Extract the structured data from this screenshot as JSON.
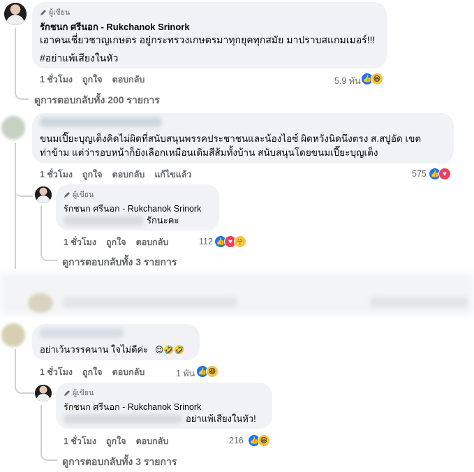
{
  "comment1": {
    "author_badge": "ผู้เขียน",
    "author_name": "รักชนก ศรีนอก - Rukchanok Srinork",
    "line1": "เอาคนเชี่ยวชาญเกษตร อยู่กระทรวงเกษตรมาทุกยุคทุกสมัย มาปราบสแกมเมอร์!!!",
    "line2": "#อย่าแพ้เสียงในหัว",
    "time": "1 ชั่วโมง",
    "like_label": "ถูกใจ",
    "reply_label": "ตอบกลับ",
    "reaction_count": "5.9 พัน",
    "view_replies": "ดูการตอบกลับทั้ง 200 รายการ"
  },
  "comment2": {
    "line1": "ขนมเปี๊ยะบุญเต็งคิดไม่ผิดที่สนับสนุนพรรคประชาชนและน้องไอซ์ ผิดหวังนิดนึงตรง ส.สปูอัด เขต",
    "line2": "ท่าข้าม แต่ว่ารอบหน้าก็ยังเลือกเหมือนเดิมสีส้มทั้งบ้าน สนับสนุนโดยขนมเปี๊ยะบุญเต็ง",
    "time": "1 ชั่วโมง",
    "like_label": "ถูกใจ",
    "reply_label": "ตอบกลับ",
    "edited_label": "แก้ไขแล้ว",
    "reaction_count": "575"
  },
  "reply2": {
    "author_badge": "ผู้เขียน",
    "author_name": "รักชนก ศรีนอก - Rukchanok Srinork",
    "text": "รักนะคะ",
    "time": "1 ชั่วโมง",
    "like_label": "ถูกใจ",
    "reply_label": "ตอบกลับ",
    "reaction_count": "112",
    "view_replies": "ดูการตอบกลับทั้ง 3 รายการ"
  },
  "comment3": {
    "text": "อย่าเว้นวรรคนาน ใจไม่ดีค่ะ",
    "emojis": "😌🤣🤣",
    "time": "1 ชั่วโมง",
    "like_label": "ถูกใจ",
    "reply_label": "ตอบกลับ",
    "reaction_count": "1 พัน"
  },
  "reply3": {
    "author_badge": "ผู้เขียน",
    "author_name": "รักชนก ศรีนอก - Rukchanok Srinork",
    "text": "อย่าแพ้เสียงในหัว!",
    "time": "1 ชั่วโมง",
    "like_label": "ถูกใจ",
    "reply_label": "ตอบกลับ",
    "reaction_count": "216",
    "view_replies": "ดูการตอบกลับทั้ง 3 รายการ"
  },
  "colors": {
    "bubble": "#f0f2f5",
    "secondary_text": "#65676b",
    "like_blue": "#1877f2",
    "love_red": "#f33e58",
    "haha_yellow": "#f7c33e"
  },
  "icons": {
    "like": "like-reaction-icon",
    "haha": "haha-reaction-icon",
    "love": "love-reaction-icon",
    "care": "care-reaction-icon",
    "pen": "pen-icon"
  }
}
